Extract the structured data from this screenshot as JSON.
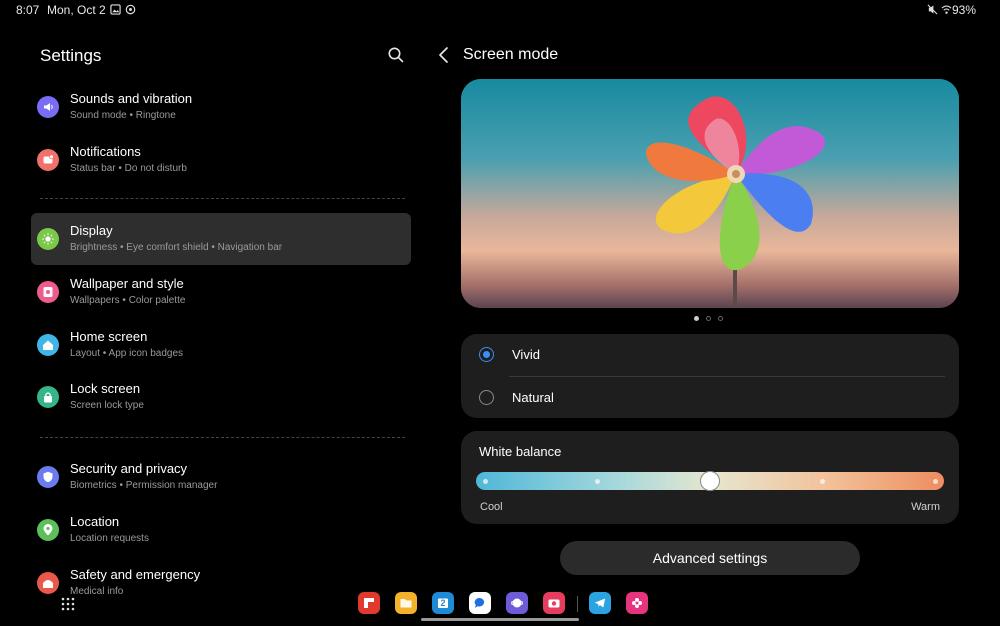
{
  "status_bar": {
    "time": "8:07",
    "date": "Mon, Oct 2",
    "battery": "93%",
    "left_icons": [
      "gallery-notification-icon",
      "sync-notification-icon"
    ],
    "right_icons": [
      "mute-icon",
      "wifi-icon"
    ]
  },
  "left_panel": {
    "title": "Settings",
    "search_icon": "search-icon",
    "items": [
      {
        "title": "Sounds and vibration",
        "subtitle": "Sound mode  •  Ringtone",
        "icon": "speaker-icon",
        "color": "#7b6cf6"
      },
      {
        "title": "Notifications",
        "subtitle": "Status bar  •  Do not disturb",
        "icon": "notification-icon",
        "color": "#f0706a"
      },
      {
        "title": "Display",
        "subtitle": "Brightness  •  Eye comfort shield  •  Navigation bar",
        "icon": "sun-icon",
        "color": "#7cc84a",
        "selected": true
      },
      {
        "title": "Wallpaper and style",
        "subtitle": "Wallpapers  •  Color palette",
        "icon": "wallpaper-icon",
        "color": "#ef5b8f"
      },
      {
        "title": "Home screen",
        "subtitle": "Layout  •  App icon badges",
        "icon": "home-icon",
        "color": "#3fb5e8"
      },
      {
        "title": "Lock screen",
        "subtitle": "Screen lock type",
        "icon": "lock-icon",
        "color": "#35b58a"
      },
      {
        "title": "Security and privacy",
        "subtitle": "Biometrics  •  Permission manager",
        "icon": "shield-icon",
        "color": "#6a7cf0"
      },
      {
        "title": "Location",
        "subtitle": "Location requests",
        "icon": "location-pin-icon",
        "color": "#5cbf5a"
      },
      {
        "title": "Safety and emergency",
        "subtitle": "Medical info",
        "icon": "emergency-icon",
        "color": "#e9584a"
      }
    ]
  },
  "right_panel": {
    "title": "Screen mode",
    "back_icon": "back-chevron-icon",
    "preview_pages": 3,
    "preview_active_page": 1,
    "modes": [
      {
        "label": "Vivid",
        "checked": true
      },
      {
        "label": "Natural",
        "checked": false
      }
    ],
    "white_balance": {
      "title": "White balance",
      "min_label": "Cool",
      "max_label": "Warm",
      "steps": 5,
      "value_step": 3
    },
    "advanced_button": "Advanced settings"
  },
  "taskbar": {
    "apps_icon": "apps-grid-icon",
    "apps": [
      {
        "name": "flipboard-icon",
        "color": "#e03a2f"
      },
      {
        "name": "my-files-icon",
        "color": "#f3b22b"
      },
      {
        "name": "calendar-icon",
        "color": "#1f8bd6",
        "badge": "2"
      },
      {
        "name": "messages-icon",
        "color": "#ffffff"
      },
      {
        "name": "internet-icon",
        "color": "#6d5bd8"
      },
      {
        "name": "camera-icon",
        "color": "#e63c5e"
      },
      {
        "name": "telegram-icon",
        "color": "#2aa3e0"
      },
      {
        "name": "blossom-app-icon",
        "color": "#e7347e"
      }
    ]
  }
}
